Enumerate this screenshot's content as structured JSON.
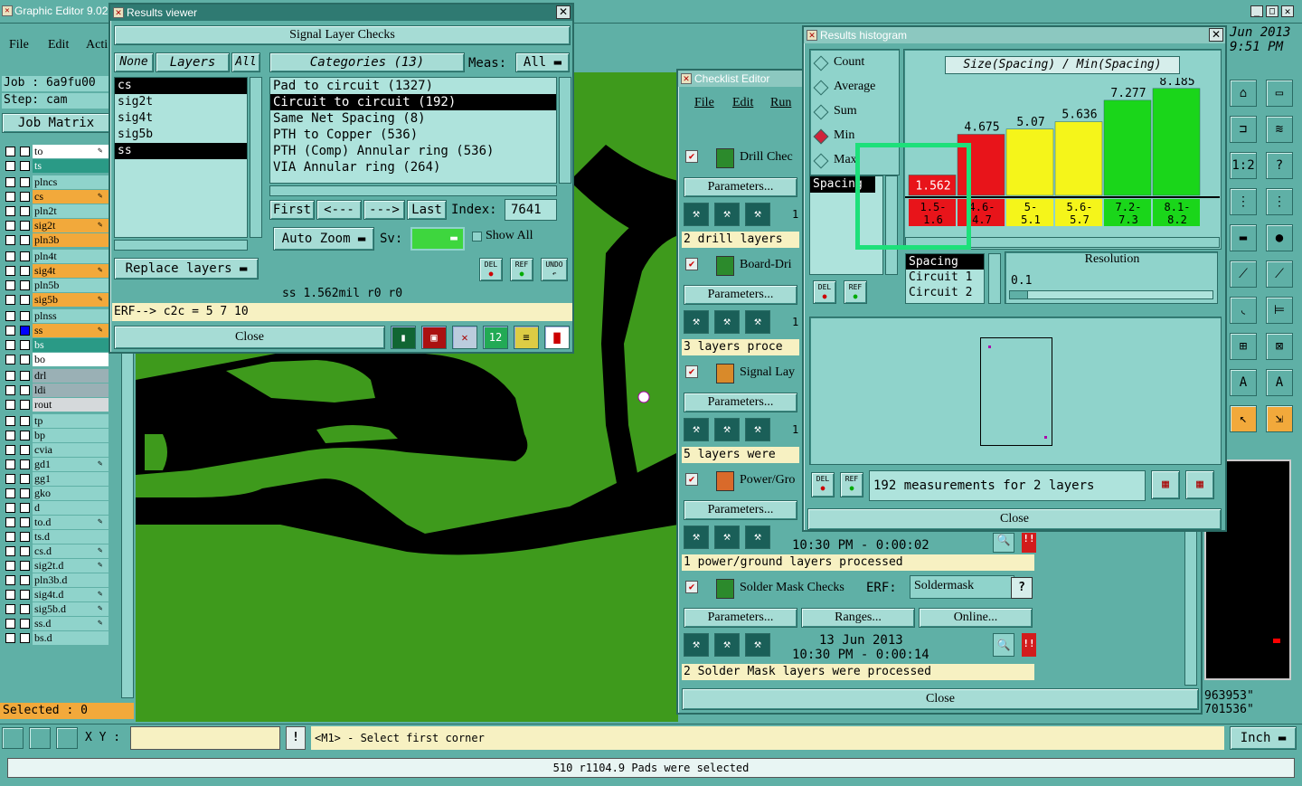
{
  "main": {
    "title": "Graphic Editor 9.02",
    "menu": [
      "File",
      "Edit",
      "Acti"
    ],
    "job_label": "Job : 6a9fu00",
    "step_label": "Step: cam",
    "job_matrix": "Job Matrix",
    "selected": "Selected : 0",
    "xy_label": "X Y :",
    "prompt": "<M1> - Select first corner",
    "units": "Inch",
    "status": "510 r1104.9 Pads were selected",
    "clock1": "Jun 2013",
    "clock2": "9:51 PM",
    "coord1": "963953\"",
    "coord2": "701536\""
  },
  "layers": [
    {
      "name": "to",
      "color": "#ffffff",
      "edit": true
    },
    {
      "name": "ts",
      "color": "#2a9a86",
      "edit": false
    },
    {
      "name": "plncs",
      "color": "#8fd3cb",
      "edit": false
    },
    {
      "name": "cs",
      "color": "#f2a93b",
      "edit": true
    },
    {
      "name": "pln2t",
      "color": "#8fd3cb",
      "edit": false
    },
    {
      "name": "sig2t",
      "color": "#f2a93b",
      "edit": true
    },
    {
      "name": "pln3b",
      "color": "#f2a93b",
      "edit": false
    },
    {
      "name": "pln4t",
      "color": "#8fd3cb",
      "edit": false
    },
    {
      "name": "sig4t",
      "color": "#f2a93b",
      "edit": true
    },
    {
      "name": "pln5b",
      "color": "#8fd3cb",
      "edit": false
    },
    {
      "name": "sig5b",
      "color": "#f2a93b",
      "edit": true
    },
    {
      "name": "plnss",
      "color": "#8fd3cb",
      "edit": false
    },
    {
      "name": "ss",
      "color": "#f2a93b",
      "edit": true
    },
    {
      "name": "bs",
      "color": "#2a9a86",
      "edit": false
    },
    {
      "name": "bo",
      "color": "#ffffff",
      "edit": false
    },
    {
      "name": "drl",
      "color": "#9ab0b5",
      "edit": false
    },
    {
      "name": "ldi",
      "color": "#9ab0b5",
      "edit": false
    },
    {
      "name": "rout",
      "color": "#d5d9db",
      "edit": false
    },
    {
      "name": "tp",
      "color": "#8fd3cb",
      "edit": false
    },
    {
      "name": "bp",
      "color": "#8fd3cb",
      "edit": false
    },
    {
      "name": "cvia",
      "color": "#8fd3cb",
      "edit": false
    },
    {
      "name": "gd1",
      "color": "#8fd3cb",
      "edit": true
    },
    {
      "name": "gg1",
      "color": "#8fd3cb",
      "edit": false
    },
    {
      "name": "gko",
      "color": "#8fd3cb",
      "edit": false
    },
    {
      "name": "d",
      "color": "#8fd3cb",
      "edit": false
    },
    {
      "name": "to.d",
      "color": "#8fd3cb",
      "edit": true
    },
    {
      "name": "ts.d",
      "color": "#8fd3cb",
      "edit": false
    },
    {
      "name": "cs.d",
      "color": "#8fd3cb",
      "edit": true
    },
    {
      "name": "sig2t.d",
      "color": "#8fd3cb",
      "edit": true
    },
    {
      "name": "pln3b.d",
      "color": "#8fd3cb",
      "edit": false
    },
    {
      "name": "sig4t.d",
      "color": "#8fd3cb",
      "edit": true
    },
    {
      "name": "sig5b.d",
      "color": "#8fd3cb",
      "edit": true
    },
    {
      "name": "ss.d",
      "color": "#8fd3cb",
      "edit": true
    },
    {
      "name": "bs.d",
      "color": "#8fd3cb",
      "edit": false
    }
  ],
  "results_viewer": {
    "title": "Results viewer",
    "header": "Signal Layer Checks",
    "none": "None",
    "layers_tab": "Layers",
    "all": "All",
    "categories_label": "Categories (13)",
    "meas_label": "Meas:",
    "meas_value": "All",
    "layer_list": [
      "cs",
      "sig2t",
      "sig4t",
      "sig5b",
      "ss"
    ],
    "categories": [
      "Pad to circuit (1327)",
      "Circuit to circuit (192)",
      "Same Net Spacing (8)",
      "PTH to Copper (536)",
      "PTH (Comp) Annular ring (536)",
      "VIA Annular ring (264)"
    ],
    "first": "First",
    "prev": "<---",
    "next": "--->",
    "last": "Last",
    "index_label": "Index:",
    "index_value": "7641",
    "auto_zoom": "Auto Zoom",
    "sv_label": "Sv:",
    "show_all": "Show All",
    "replace_layers": "Replace layers",
    "del": "DEL",
    "ref": "REF",
    "undo": "UNDO",
    "readout": "ss 1.562mil  r0  r0",
    "erf": "ERF--> c2c = 5 7 10",
    "close": "Close"
  },
  "checklist": {
    "title": "Checklist Editor",
    "menu": [
      "File",
      "Edit",
      "Run"
    ],
    "items": [
      {
        "name": "Drill Chec",
        "params": "Parameters...",
        "status": "2 drill layers"
      },
      {
        "name": "Board-Dri",
        "params": "Parameters...",
        "status": "3 layers proce"
      },
      {
        "name": "Signal Lay",
        "params": "Parameters...",
        "status": "5 layers were"
      },
      {
        "name": "Power/Gro",
        "params": "Parameters...",
        "status": "1 power/ground layers processed",
        "time": "10:30 PM - 0:00:02"
      },
      {
        "name": "Solder Mask Checks",
        "params": "Parameters...",
        "ranges": "Ranges...",
        "online": "Online...",
        "erf_label": "ERF:",
        "erf_value": "Soldermask",
        "date": "13 Jun 2013",
        "time": "10:30 PM - 0:00:14",
        "status": "2 Solder Mask layers were processed"
      }
    ],
    "one": "1",
    "close": "Close"
  },
  "histogram": {
    "title": "Results histogram",
    "modes": [
      "Count",
      "Average",
      "Sum",
      "Min",
      "Max"
    ],
    "selected_mode": "Min",
    "chart_title": "Size(Spacing) / Min(Spacing)",
    "field_list": [
      "Spacing",
      "Circuit 1",
      "Circuit 2"
    ],
    "left_field": "Spacing",
    "resolution_label": "Resolution",
    "resolution_value": "0.1",
    "summary": "192 measurements for 2 layers",
    "close": "Close",
    "del": "DEL",
    "ref": "REF"
  },
  "chart_data": {
    "type": "bar",
    "title": "Size(Spacing) / Min(Spacing)",
    "categories": [
      "1.5-1.6",
      "4.6-4.7",
      "5-5.1",
      "5.6-5.7",
      "7.2-7.3",
      "8.1-8.2"
    ],
    "values": [
      1.562,
      4.675,
      5.07,
      5.636,
      7.277,
      8.185
    ],
    "value_labels": [
      "1.562",
      "4.675",
      "5.07",
      "5.636",
      "7.277",
      "8.185"
    ],
    "colors": [
      "#e8141a",
      "#e8141a",
      "#f5f51a",
      "#f5f51a",
      "#1ad61a",
      "#1ad61a"
    ],
    "ylim": [
      0,
      9
    ]
  }
}
